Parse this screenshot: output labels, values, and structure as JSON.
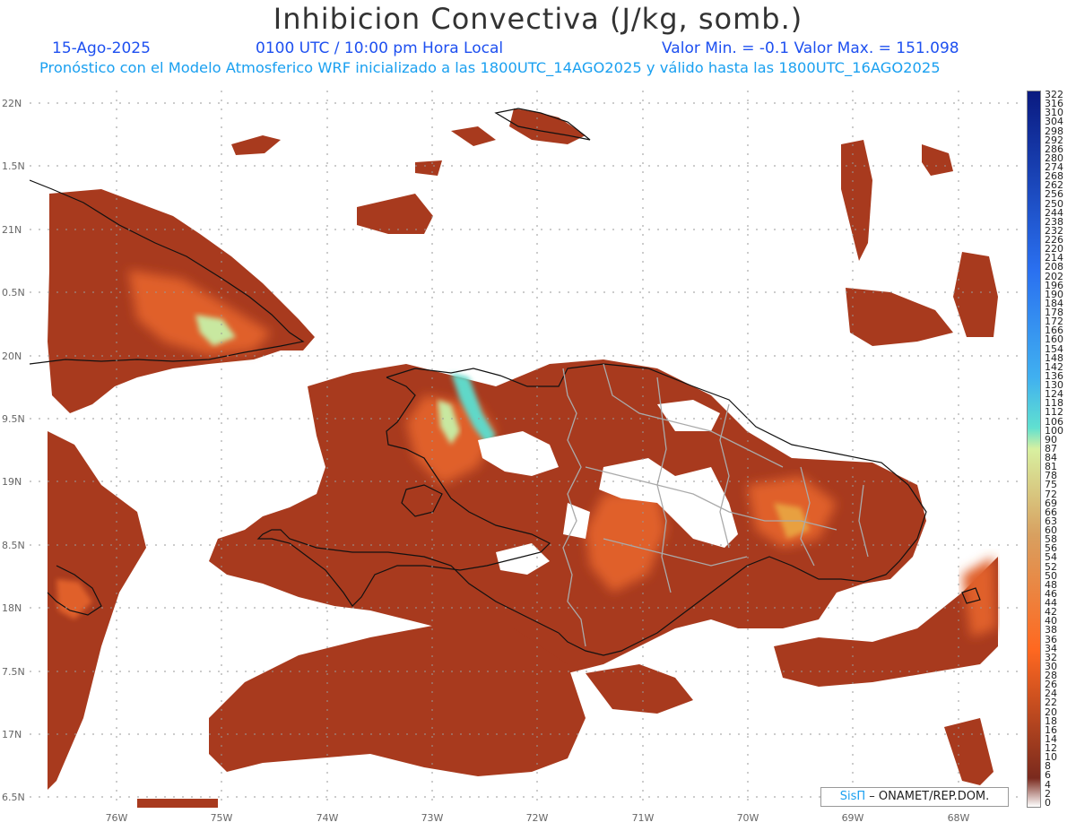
{
  "header": {
    "title": "Inhibicion Convectiva (J/kg, somb.)",
    "date": "15-Ago-2025",
    "time": "0100 UTC / 10:00 pm Hora Local",
    "min_max": "Valor Min. = -0.1  Valor Max. = 151.098",
    "model_info": "Pronóstico con el Modelo Atmosferico WRF inicializado a las 1800UTC_14AGO2025 y válido hasta las  1800UTC_16AGO2025"
  },
  "axes": {
    "lat_labels": [
      "22N",
      "1.5N",
      "21N",
      "0.5N",
      "20N",
      "9.5N",
      "19N",
      "8.5N",
      "18N",
      "7.5N",
      "17N",
      "6.5N"
    ],
    "lon_labels": [
      "76W",
      "75W",
      "74W",
      "73W",
      "72W",
      "71W",
      "70W",
      "69W",
      "68W"
    ]
  },
  "colorbar": {
    "labels": [
      "322",
      "316",
      "310",
      "304",
      "298",
      "292",
      "286",
      "280",
      "274",
      "268",
      "262",
      "256",
      "250",
      "244",
      "238",
      "232",
      "226",
      "220",
      "214",
      "208",
      "202",
      "196",
      "190",
      "184",
      "178",
      "172",
      "166",
      "160",
      "154",
      "148",
      "142",
      "136",
      "130",
      "124",
      "118",
      "112",
      "106",
      "100",
      "90",
      "87",
      "84",
      "81",
      "78",
      "75",
      "72",
      "69",
      "66",
      "63",
      "60",
      "58",
      "56",
      "54",
      "52",
      "50",
      "48",
      "46",
      "44",
      "42",
      "40",
      "38",
      "36",
      "34",
      "32",
      "30",
      "28",
      "26",
      "24",
      "22",
      "20",
      "18",
      "16",
      "14",
      "12",
      "10",
      "8",
      "6",
      "4",
      "2",
      "0"
    ],
    "low_color": "#7a2a1e",
    "mid_color": "#ff6820",
    "green_color": "#d8f0a0",
    "cyan_color": "#60e0d0",
    "high_color": "#0a1a80"
  },
  "credit": {
    "brand": "SisΠ",
    "org": "– ONAMET/REP.DOM."
  },
  "colors": {
    "field_base": "#a83a1e",
    "field_hot": "#e8602a",
    "field_green": "#c8e8a0",
    "field_cyan": "#60d8c8",
    "coast": "#111111",
    "provinces": "#aaaaaa"
  }
}
